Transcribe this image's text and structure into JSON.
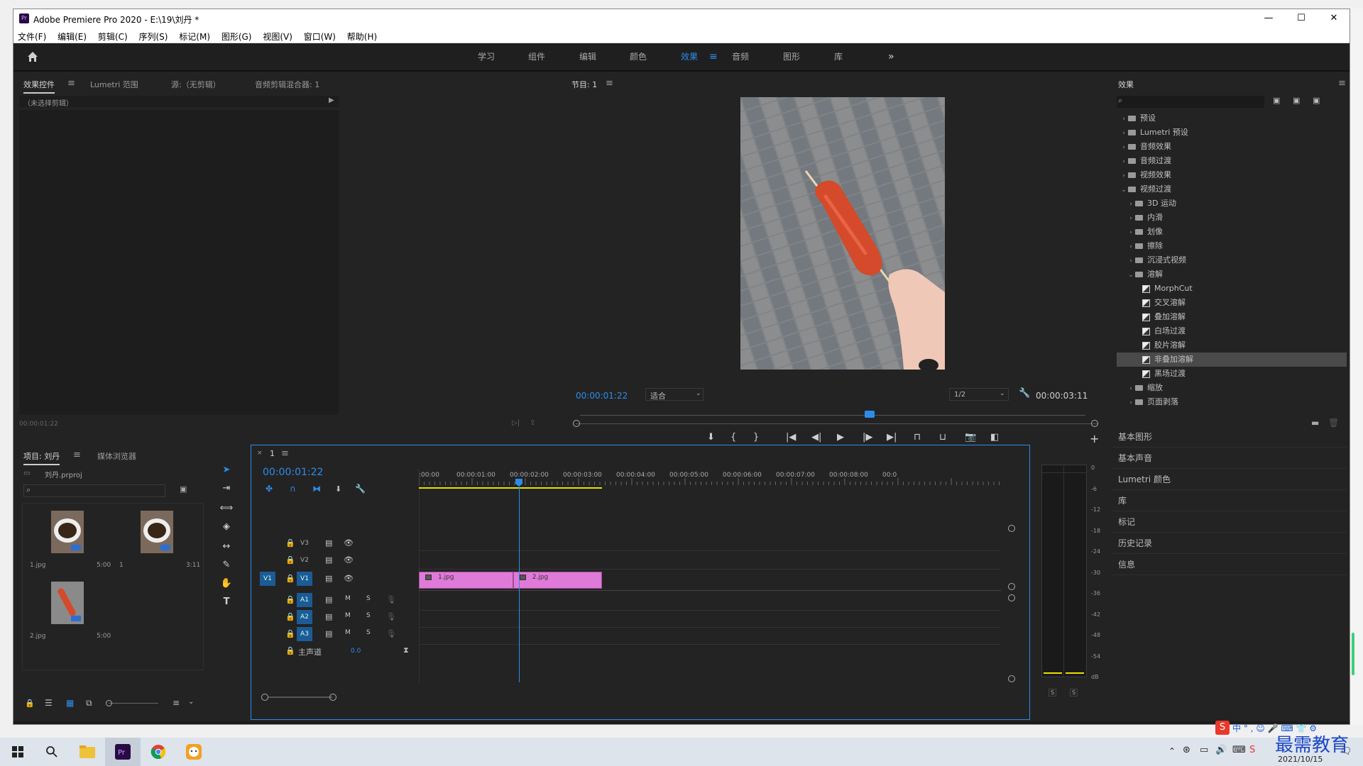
{
  "window": {
    "title": "Adobe Premiere Pro 2020 - E:\\19\\刘丹 *",
    "app_badge": "Pr",
    "controls": {
      "minimize": "—",
      "maximize": "☐",
      "close": "✕"
    }
  },
  "menu": [
    "文件(F)",
    "编辑(E)",
    "剪辑(C)",
    "序列(S)",
    "标记(M)",
    "图形(G)",
    "视图(V)",
    "窗口(W)",
    "帮助(H)"
  ],
  "workspaces": {
    "items": [
      "学习",
      "组件",
      "编辑",
      "颜色",
      "效果",
      "音频",
      "图形",
      "库"
    ],
    "active": "效果",
    "more": "»"
  },
  "effect_controls": {
    "tabs": [
      "效果控件",
      "Lumetri 范围",
      "源:（无剪辑）",
      "音频剪辑混合器: 1"
    ],
    "no_clip": "（未选择剪辑）",
    "timecode": "00:00:01:22"
  },
  "program": {
    "title": "节目: 1",
    "timecode": "00:00:01:22",
    "fit": "适合",
    "resolution": "1/2",
    "duration": "00:00:03:11"
  },
  "effects": {
    "title": "效果",
    "tree": [
      {
        "label": "预设",
        "kind": "folder",
        "depth": 0,
        "open": false
      },
      {
        "label": "Lumetri 预设",
        "kind": "folder",
        "depth": 0,
        "open": false
      },
      {
        "label": "音频效果",
        "kind": "folder",
        "depth": 0,
        "open": false
      },
      {
        "label": "音频过渡",
        "kind": "folder",
        "depth": 0,
        "open": false
      },
      {
        "label": "视频效果",
        "kind": "folder",
        "depth": 0,
        "open": false
      },
      {
        "label": "视频过渡",
        "kind": "folder",
        "depth": 0,
        "open": true
      },
      {
        "label": "3D 运动",
        "kind": "folder",
        "depth": 1,
        "open": false
      },
      {
        "label": "内滑",
        "kind": "folder",
        "depth": 1,
        "open": false
      },
      {
        "label": "划像",
        "kind": "folder",
        "depth": 1,
        "open": false
      },
      {
        "label": "擦除",
        "kind": "folder",
        "depth": 1,
        "open": false
      },
      {
        "label": "沉浸式视频",
        "kind": "folder",
        "depth": 1,
        "open": false
      },
      {
        "label": "溶解",
        "kind": "folder",
        "depth": 1,
        "open": true
      },
      {
        "label": "MorphCut",
        "kind": "effect",
        "depth": 2
      },
      {
        "label": "交叉溶解",
        "kind": "effect",
        "depth": 2
      },
      {
        "label": "叠加溶解",
        "kind": "effect",
        "depth": 2
      },
      {
        "label": "白场过渡",
        "kind": "effect",
        "depth": 2
      },
      {
        "label": "胶片溶解",
        "kind": "effect",
        "depth": 2
      },
      {
        "label": "非叠加溶解",
        "kind": "effect",
        "depth": 2,
        "selected": true
      },
      {
        "label": "黑场过渡",
        "kind": "effect",
        "depth": 2
      },
      {
        "label": "缩放",
        "kind": "folder",
        "depth": 1,
        "open": false
      },
      {
        "label": "页面剥落",
        "kind": "folder",
        "depth": 1,
        "open": false
      }
    ],
    "sections": [
      "基本图形",
      "基本声音",
      "Lumetri 颜色",
      "库",
      "标记",
      "历史记录",
      "信息"
    ]
  },
  "project": {
    "tabs": [
      "项目: 刘丹",
      "媒体浏览器"
    ],
    "file": "刘丹.prproj",
    "items": [
      {
        "name": "1.jpg",
        "dur": "5:00"
      },
      {
        "name": "1",
        "dur": "3:11"
      },
      {
        "name": "2.jpg",
        "dur": "5:00"
      }
    ]
  },
  "timeline": {
    "tab": "1",
    "timecode": "00:00:01:22",
    "ruler": [
      ":00:00",
      "00:00:01:00",
      "00:00:02:00",
      "00:00:03:00",
      "00:00:04:00",
      "00:00:05:00",
      "00:00:06:00",
      "00:00:07:00",
      "00:00:08:00",
      "00:0"
    ],
    "video_tracks": [
      "V3",
      "V2",
      "V1"
    ],
    "audio_tracks": [
      "A1",
      "A2",
      "A3"
    ],
    "source_patch": "V1",
    "master": {
      "label": "主声道",
      "value": "0.0"
    },
    "clips": [
      {
        "name": "1.jpg",
        "start": 0,
        "end": 1.77
      },
      {
        "name": "2.jpg",
        "start": 1.77,
        "end": 3.44
      }
    ],
    "playhead": 1.88,
    "track_btn": {
      "mute": "M",
      "solo": "S"
    }
  },
  "meter": {
    "labels": [
      "0",
      "-6",
      "-12",
      "-18",
      "-24",
      "-30",
      "-36",
      "-42",
      "-48",
      "-54",
      "dB"
    ],
    "solo": [
      "S",
      "S"
    ]
  },
  "taskbar": {
    "clock_date": "2021/10/15",
    "watermark": "最需教育",
    "tray": "中 ° , ☺ 🎤 ⌨ 👕 ⚙"
  },
  "colors": {
    "accent": "#2d8ceb",
    "clip": "#e07ad8",
    "panel": "#232323",
    "work_area": "#e8e000"
  }
}
